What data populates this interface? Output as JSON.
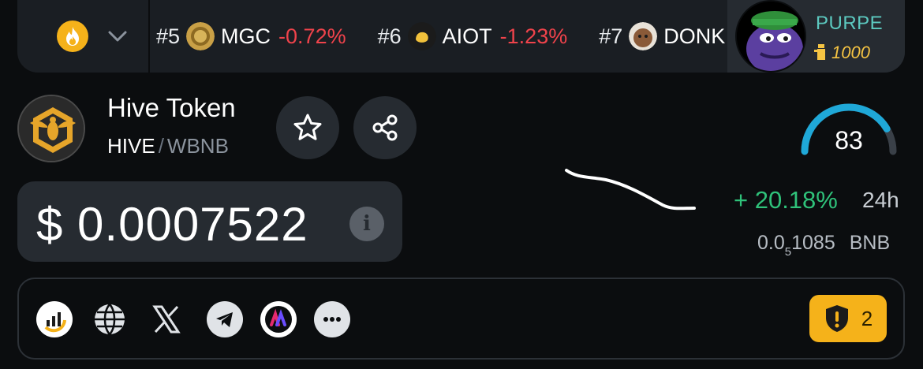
{
  "ticker": {
    "items": [
      {
        "rank": "#5",
        "symbol": "MGC",
        "change": "-0.72%"
      },
      {
        "rank": "#6",
        "symbol": "AIOT",
        "change": "-1.23%"
      },
      {
        "rank": "#7",
        "symbol": "DONK",
        "change": ""
      }
    ],
    "promo": {
      "name": "PURPE",
      "count": "1000"
    }
  },
  "token": {
    "name": "Hive Token",
    "base": "HIVE",
    "separator": "/",
    "quote": "WBNB",
    "price": "$ 0.0007522"
  },
  "stats": {
    "score": "83",
    "score_fraction": 0.83,
    "change": "+ 20.18%",
    "period": "24h",
    "native_prefix": "0.0",
    "native_zeros": "5",
    "native_digits": "1085",
    "native_unit": "BNB"
  },
  "audit": {
    "issues": "2"
  },
  "colors": {
    "positive": "#2fc27a",
    "negative": "#f0434b",
    "accent": "#f5b21a",
    "gauge": "#1fa8d8"
  },
  "icons": [
    "fire-icon",
    "chevron-down-icon",
    "star-icon",
    "share-icon",
    "info-icon",
    "chart-icon",
    "globe-icon",
    "x-icon",
    "telegram-icon",
    "dextools-icon",
    "more-icon",
    "shield-alert-icon"
  ]
}
